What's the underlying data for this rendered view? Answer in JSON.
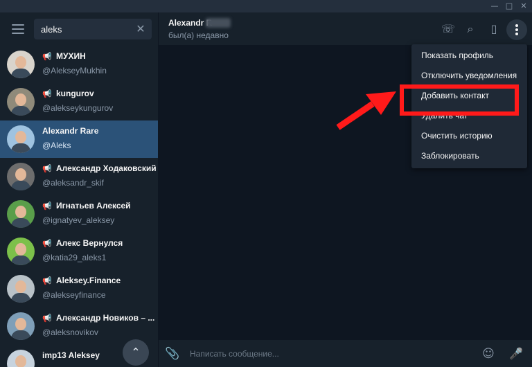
{
  "window": {
    "controls": {
      "minimize": "—",
      "maximize": "□",
      "close": "✕"
    }
  },
  "sidebar": {
    "menu_icon": "menu-icon",
    "search": {
      "value": "aleks",
      "clear_icon": "close-icon",
      "clear_glyph": "✕"
    },
    "chats": [
      {
        "name": "МУХИН",
        "handle": "@AlekseyMukhin",
        "channel": true,
        "active": false,
        "avatar_bg": "#d9d4cc"
      },
      {
        "name": "kungurov",
        "handle": "@alekseykungurov",
        "channel": true,
        "active": false,
        "avatar_bg": "#8f8a7a"
      },
      {
        "name": "Alexandr Rare",
        "handle": "@Aleks",
        "channel": false,
        "active": true,
        "avatar_bg": "#9fc3e0"
      },
      {
        "name": "Александр Ходаковский",
        "handle": "@aleksandr_skif",
        "channel": true,
        "active": false,
        "avatar_bg": "#6d6d6d"
      },
      {
        "name": "Игнатьев Алексей",
        "handle": "@ignatyev_aleksey",
        "channel": true,
        "active": false,
        "avatar_bg": "#5a9e4a"
      },
      {
        "name": "Алекс Вернулся",
        "handle": "@katia29_aleks1",
        "channel": true,
        "active": false,
        "avatar_bg": "#7cc04a"
      },
      {
        "name": "Aleksey.Finance",
        "handle": "@alekseyfinance",
        "channel": true,
        "active": false,
        "avatar_bg": "#b9c2c8"
      },
      {
        "name": "Александр Новиков – ...",
        "handle": "@aleksnovikov",
        "channel": true,
        "active": false,
        "avatar_bg": "#7f9fb8"
      },
      {
        "name": "imp13 Aleksey",
        "handle": "",
        "channel": false,
        "active": false,
        "avatar_bg": "#c7d3de"
      }
    ],
    "channel_icon": "megaphone-icon",
    "channel_glyph": "📢",
    "scroll_up_glyph": "⌃"
  },
  "header": {
    "peer_name": "Alexandr R",
    "peer_status": "был(а) недавно",
    "icons": {
      "call": "☏",
      "search": "⌕",
      "sidebar": "▯"
    }
  },
  "menu": {
    "items": [
      "Показать профиль",
      "Отключить уведомления",
      "Добавить контакт",
      "Удалить чат",
      "Очистить историю",
      "Заблокировать"
    ]
  },
  "composer": {
    "placeholder": "Написать сообщение...",
    "icons": {
      "attach": "📎",
      "emoji": "☺",
      "mic": "🎤"
    }
  },
  "colors": {
    "accent": "#2b5278",
    "annotation": "#ff1a1a"
  }
}
